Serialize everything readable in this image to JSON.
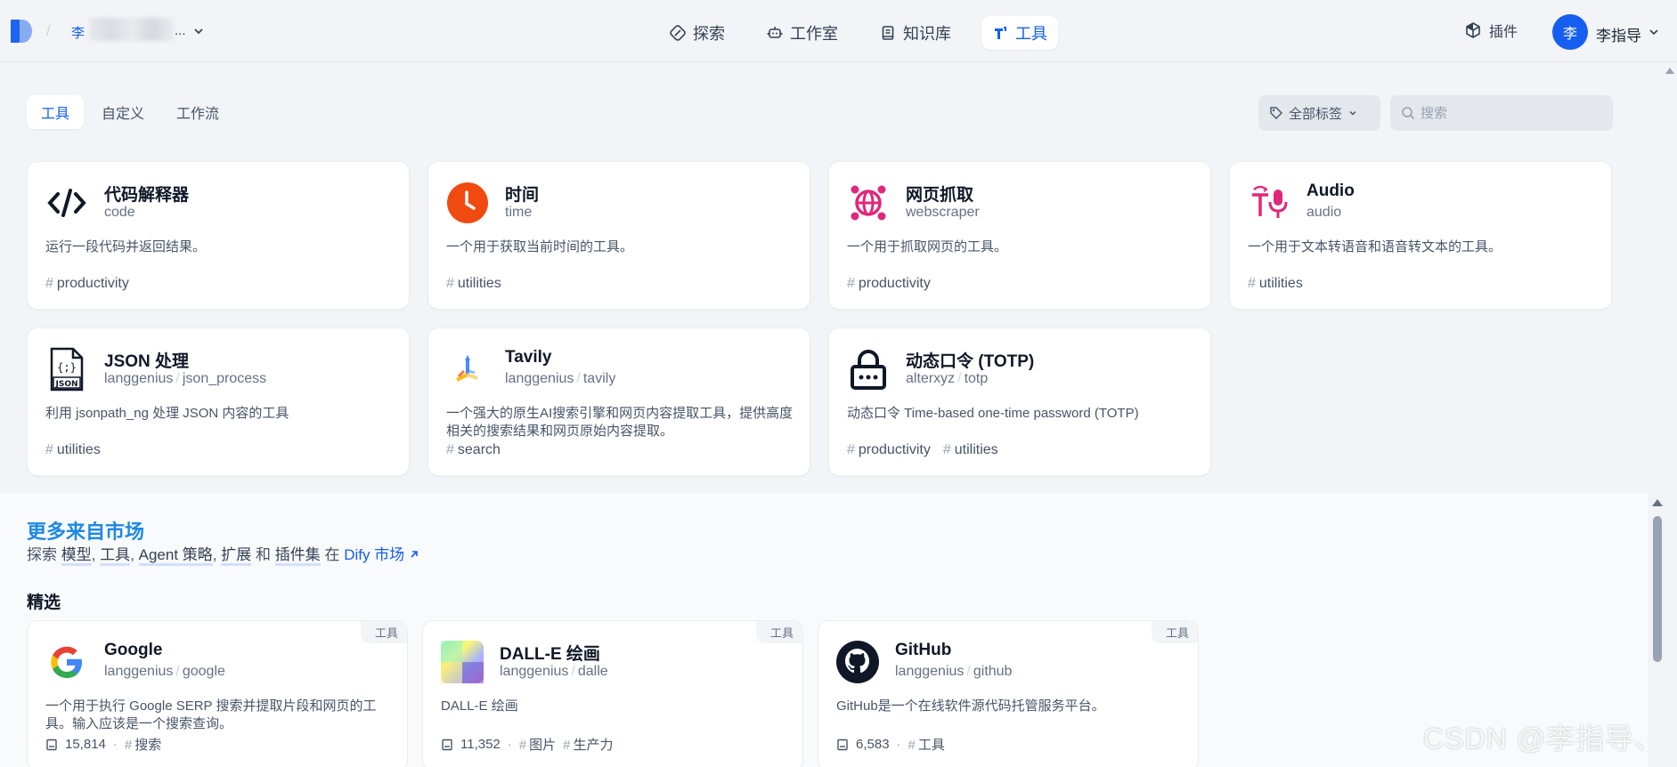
{
  "header": {
    "workspace_initial": "李",
    "workspace_ellipsis": "...",
    "nav": [
      {
        "label": "探索",
        "icon": "explore-icon"
      },
      {
        "label": "工作室",
        "icon": "robot-icon"
      },
      {
        "label": "知识库",
        "icon": "book-icon"
      },
      {
        "label": "工具",
        "icon": "tools-icon",
        "active": true
      }
    ],
    "plugin_label": "插件",
    "avatar_initial": "李",
    "user_name": "李指导"
  },
  "subtabs": [
    {
      "label": "工具",
      "active": true
    },
    {
      "label": "自定义"
    },
    {
      "label": "工作流"
    }
  ],
  "filters": {
    "tag_label": "全部标签",
    "search_placeholder": "搜索"
  },
  "tools": [
    {
      "name": "代码解释器",
      "author": "",
      "id": "code",
      "desc": "运行一段代码并返回结果。",
      "tags": [
        "productivity"
      ],
      "icon": "code-icon"
    },
    {
      "name": "时间",
      "author": "",
      "id": "time",
      "desc": "一个用于获取当前时间的工具。",
      "tags": [
        "utilities"
      ],
      "icon": "clock-icon"
    },
    {
      "name": "网页抓取",
      "author": "",
      "id": "webscraper",
      "desc": "一个用于抓取网页的工具。",
      "tags": [
        "productivity"
      ],
      "icon": "web-globe-icon"
    },
    {
      "name": "Audio",
      "author": "",
      "id": "audio",
      "desc": "一个用于文本转语音和语音转文本的工具。",
      "tags": [
        "utilities"
      ],
      "icon": "audio-icon"
    },
    {
      "name": "JSON 处理",
      "author": "langgenius",
      "id": "json_process",
      "desc": "利用 jsonpath_ng 处理 JSON 内容的工具",
      "tags": [
        "utilities"
      ],
      "icon": "json-file-icon"
    },
    {
      "name": "Tavily",
      "author": "langgenius",
      "id": "tavily",
      "desc": "一个强大的原生AI搜索引擎和网页内容提取工具，提供高度相关的搜索结果和网页原始内容提取。",
      "tags": [
        "search"
      ],
      "icon": "tavily-icon"
    },
    {
      "name": "动态口令 (TOTP)",
      "author": "alterxyz",
      "id": "totp",
      "desc": "动态口令 Time-based one-time password (TOTP)",
      "tags": [
        "productivity",
        "utilities"
      ],
      "icon": "lock-icon"
    }
  ],
  "market": {
    "title": "更多来自市场",
    "line_prefix": "探索",
    "items": [
      "模型",
      "工具",
      "Agent 策略",
      "扩展"
    ],
    "and_word": "和",
    "bundles": "插件集",
    "in_word": "在",
    "link": "Dify 市场",
    "featured_title": "精选",
    "cards": [
      {
        "badge": "工具",
        "name": "Google",
        "author": "langgenius",
        "id": "google",
        "desc": "一个用于执行 Google SERP 搜索并提取片段和网页的工具。输入应该是一个搜索查询。",
        "installs": "15,814",
        "tags": [
          "搜索"
        ],
        "icon": "google-icon"
      },
      {
        "badge": "工具",
        "name": "DALL-E 绘画",
        "author": "langgenius",
        "id": "dalle",
        "desc": "DALL-E 绘画",
        "installs": "11,352",
        "tags": [
          "图片",
          "生产力"
        ],
        "icon": "dalle-icon"
      },
      {
        "badge": "工具",
        "name": "GitHub",
        "author": "langgenius",
        "id": "github",
        "desc": "GitHub是一个在线软件源代码托管服务平台。",
        "installs": "6,583",
        "tags": [
          "工具"
        ],
        "icon": "github-icon"
      }
    ]
  },
  "watermark": "CSDN @李指导、",
  "colors": {
    "accent": "#155eef",
    "market_title": "#1e88e5",
    "background": "#f2f4f7"
  }
}
